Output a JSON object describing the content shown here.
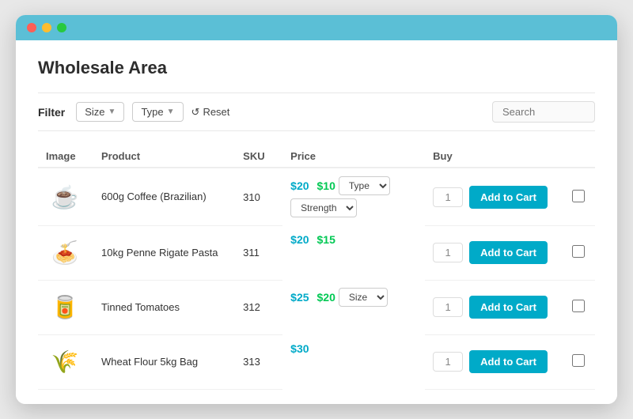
{
  "window": {
    "title": "Wholesale Area"
  },
  "filter": {
    "label": "Filter",
    "size_label": "Size",
    "type_label": "Type",
    "reset_label": "Reset",
    "search_placeholder": "Search"
  },
  "table": {
    "headers": [
      "Image",
      "Product",
      "SKU",
      "Price",
      "",
      "",
      "Buy",
      ""
    ],
    "rows": [
      {
        "image_icon": "☕",
        "product": "600g Coffee (Brazilian)",
        "sku": "310",
        "price_old": "$20",
        "price_new": "$10",
        "has_type": true,
        "has_strength": true,
        "has_size": false,
        "qty": "1",
        "add_label": "Add to Cart"
      },
      {
        "image_icon": "🍝",
        "product": "10kg Penne Rigate Pasta",
        "sku": "311",
        "price_old": "$20",
        "price_new": "$15",
        "has_type": false,
        "has_strength": false,
        "has_size": false,
        "qty": "1",
        "add_label": "Add to Cart"
      },
      {
        "image_icon": "🥫",
        "product": "Tinned Tomatoes",
        "sku": "312",
        "price_old": "$25",
        "price_new": "$20",
        "has_type": false,
        "has_strength": false,
        "has_size": true,
        "qty": "1",
        "add_label": "Add to Cart"
      },
      {
        "image_icon": "🌾",
        "product": "Wheat Flour 5kg Bag",
        "sku": "313",
        "price_old": "",
        "price_new": "",
        "price_only": "$30",
        "has_type": false,
        "has_strength": false,
        "has_size": false,
        "qty": "1",
        "add_label": "Add to Cart"
      }
    ]
  }
}
